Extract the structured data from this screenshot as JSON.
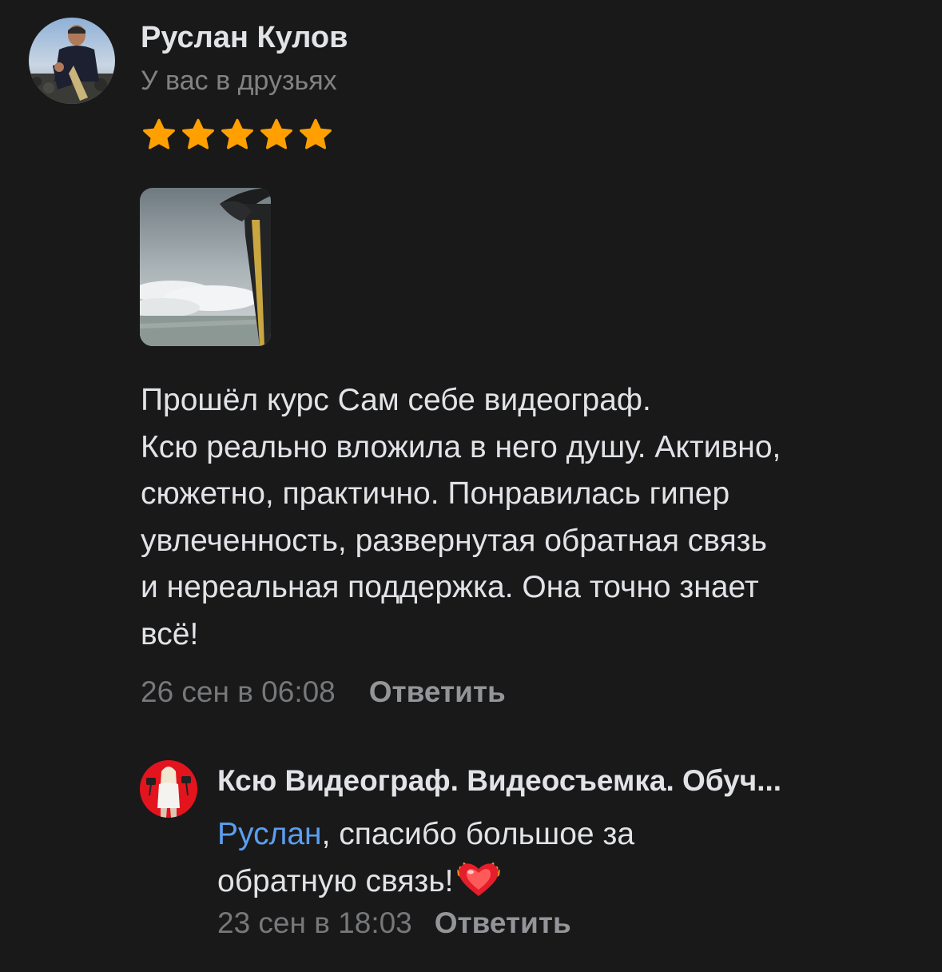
{
  "review": {
    "author_name": "Руслан Кулов",
    "author_status": "У вас в друзьях",
    "rating": 5,
    "text_lines": [
      "Прошёл курс Сам себе видеограф.",
      "Ксю реально вложила в него душу. Активно,",
      "сюжетно, практично. Понравилась гипер",
      "увлеченность, развернутая обратная связь",
      "и нереальная поддержка. Она точно знает",
      "всё!"
    ],
    "date": "26 сен в 06:08",
    "reply_label": "Ответить"
  },
  "reply": {
    "author_name": "Ксю Видеограф. Видеосъемка. Обуч...",
    "mention": "Руслан",
    "text_line1_rest": ", спасибо большое за",
    "text_line2": "обратную связь!",
    "emoji": "heart-on-fire",
    "date": "23 сен в 18:03",
    "reply_label": "Ответить"
  },
  "colors": {
    "background": "#19191a",
    "star": "#ffa000",
    "link": "#5b9eef",
    "secondary_text": "#76787a"
  }
}
